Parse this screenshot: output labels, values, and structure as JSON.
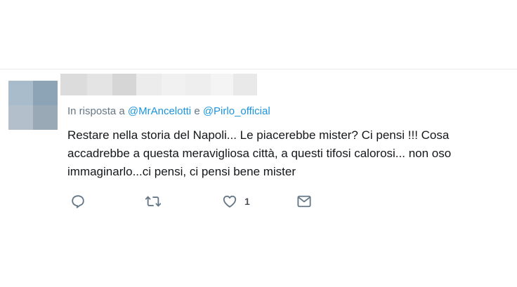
{
  "tweet": {
    "author_name_blurred": true,
    "reply_prefix": "In risposta a",
    "mention_1": "@MrAncelotti",
    "reply_conjunction": "e",
    "mention_2": "@Pirlo_official",
    "text": "Restare nella storia del Napoli... Le piacerebbe mister? Ci pensi !!! Cosa accadrebbe a questa meravigliosa città, a questi tifosi calorosi... non oso immaginarlo...ci pensi, ci pensi bene mister",
    "actions": {
      "reply_icon": "reply-icon",
      "retweet_icon": "retweet-icon",
      "like_icon": "heart-icon",
      "like_count": "1",
      "message_icon": "envelope-icon"
    }
  },
  "colors": {
    "text": "#14171a",
    "secondary": "#657786",
    "mention": "#1b95e0",
    "divider": "#e6ecf0"
  }
}
